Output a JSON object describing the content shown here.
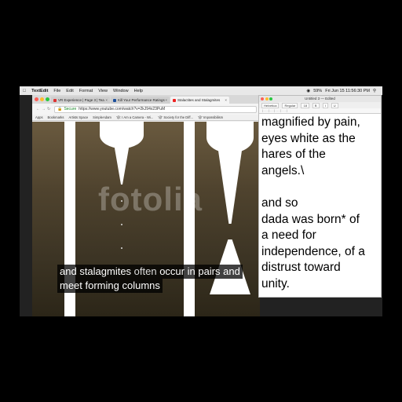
{
  "menubar": {
    "apple_icon": "apple-icon",
    "app_name": "TextEdit",
    "items": [
      "File",
      "Edit",
      "Format",
      "View",
      "Window",
      "Help"
    ],
    "battery": "59%",
    "datetime": "Fri Jun 15  11:56:30 PM"
  },
  "browser": {
    "tabs": [
      {
        "label": "VR Experience | Page 3 | Tea",
        "favicon_color": "#d33"
      },
      {
        "label": "Kill Your Performance Ratings",
        "favicon_color": "#1b4f9c"
      },
      {
        "label": "Stalactites and Stalagmites",
        "favicon_color": "#e22"
      }
    ],
    "address": {
      "secure_label": "Secure",
      "url": "https://www.youtube.com/watch?v=2kJ94x23PuM"
    },
    "bookmarks": [
      "Apps",
      "Bookmarks",
      "Artists Space",
      "SimpleAdam",
      "'@: I Am a Camera - Wi...",
      "'@' Society for the Diff...",
      "'@' Impossibilism"
    ]
  },
  "video": {
    "watermark": "fotolia",
    "caption_line1_a": "and ",
    "caption_line1_b": "stalagmites",
    "caption_line1_c": " often ",
    "caption_line1_d": "occur in pairs and",
    "caption_line2": "meet forming columns"
  },
  "textedit": {
    "title": "Untitled 3 — Edited",
    "toolbar": [
      "Helvetica",
      "Regular",
      "18",
      "B",
      "I",
      "U"
    ],
    "lines": [
      "magnified by pain,",
      "eyes white as the",
      "hares of the",
      "angels.\\",
      "",
      "and so",
      "dada was born* of",
      "a need for",
      "independence, of a",
      "distrust toward",
      "unity."
    ]
  }
}
